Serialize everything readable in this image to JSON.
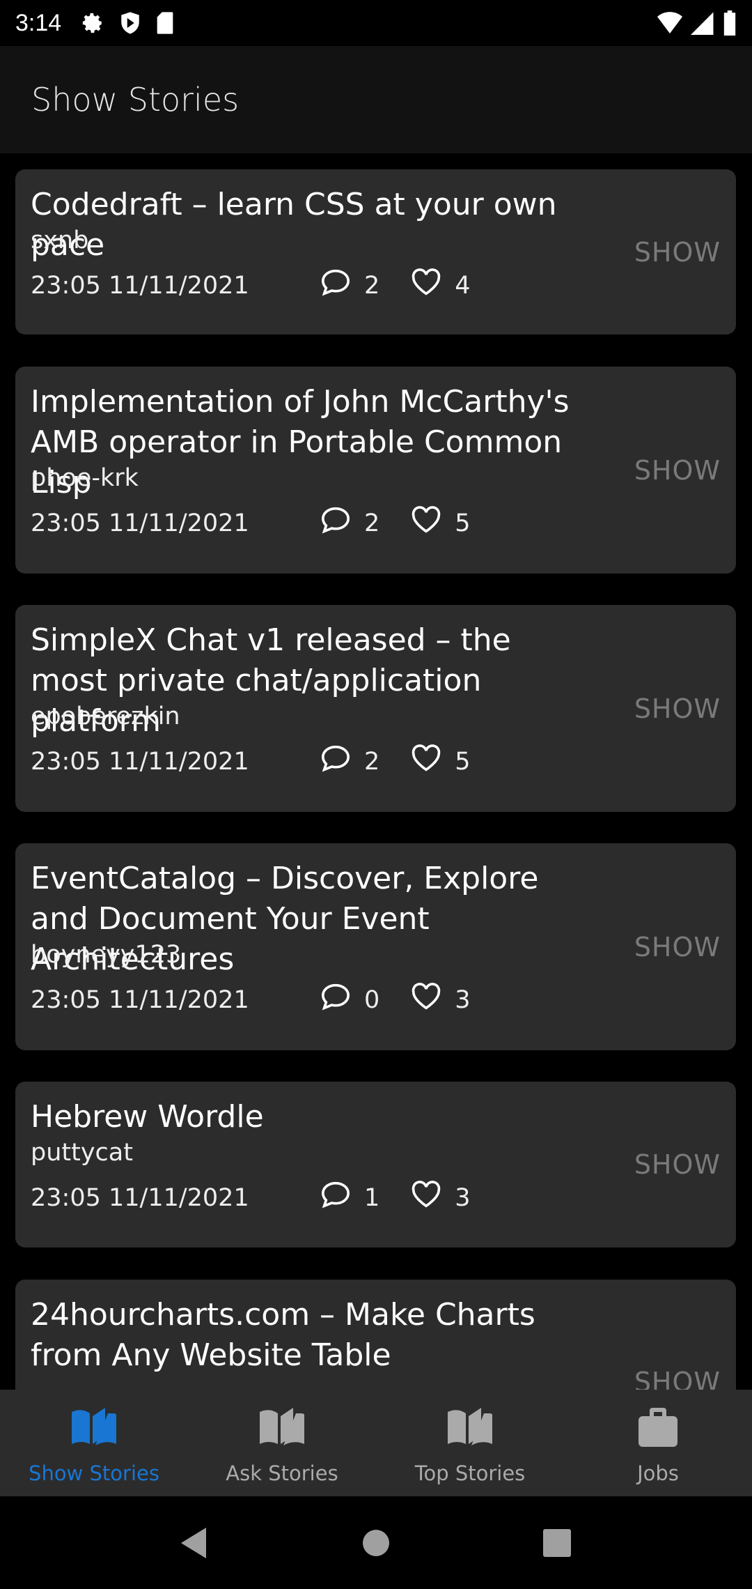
{
  "status_bar": {
    "time": "3:14",
    "icons": [
      "gear-icon",
      "shield-play-icon",
      "sd-card-icon",
      "wifi-icon",
      "signal-icon",
      "battery-icon"
    ]
  },
  "app_bar": {
    "title": "Show Stories"
  },
  "stories": [
    {
      "title": "Codedraft – learn CSS at your own pace",
      "author": "sxnb",
      "time": "23:05 11/11/2021",
      "comments": "2",
      "likes": "4",
      "tag": "SHOW"
    },
    {
      "title": "Implementation of John McCarthy's AMB operator in Portable Common Lisp",
      "author": "phoe-krk",
      "time": "23:05 11/11/2021",
      "comments": "2",
      "likes": "5",
      "tag": "SHOW"
    },
    {
      "title": "SimpleX Chat v1 released – the most private chat/application platform",
      "author": "epoberezkin",
      "time": "23:05 11/11/2021",
      "comments": "2",
      "likes": "5",
      "tag": "SHOW"
    },
    {
      "title": "EventCatalog – Discover, Explore and Document Your Event Architectures",
      "author": "boyneyy123",
      "time": "23:05 11/11/2021",
      "comments": "0",
      "likes": "3",
      "tag": "SHOW"
    },
    {
      "title": "Hebrew Wordle",
      "author": "puttycat",
      "time": "23:05 11/11/2021",
      "comments": "1",
      "likes": "3",
      "tag": "SHOW"
    },
    {
      "title": "24hourcharts.com – Make Charts from Any Website Table",
      "author": "",
      "time": "",
      "comments": "",
      "likes": "",
      "tag": "SHOW"
    }
  ],
  "bottom_nav": {
    "active": 0,
    "active_color": "#1976d2",
    "tabs": [
      {
        "label": "Show Stories",
        "icon": "book-icon"
      },
      {
        "label": "Ask Stories",
        "icon": "book-icon"
      },
      {
        "label": "Top Stories",
        "icon": "book-icon"
      },
      {
        "label": "Jobs",
        "icon": "briefcase-icon"
      }
    ]
  }
}
